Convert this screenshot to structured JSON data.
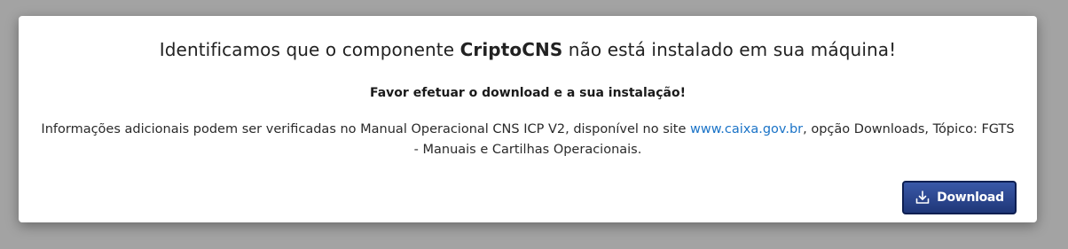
{
  "dialog": {
    "title_prefix": "Identificamos que o componente ",
    "title_strong": "CriptoCNS",
    "title_suffix": " não está instalado em sua máquina!",
    "subtitle": "Favor efetuar o download e a sua instalação!",
    "info_prefix": "Informações adicionais podem ser verificadas no Manual Operacional CNS ICP V2, disponível no site ",
    "info_link": "www.caixa.gov.br",
    "info_suffix": ", opção Downloads, Tópico: FGTS - Manuais e Cartilhas Operacionais.",
    "download_label": "Download",
    "download_icon": "download-icon"
  },
  "colors": {
    "backdrop": "#a3a3a3",
    "link": "#1a73c7",
    "button": "#2a4690"
  }
}
